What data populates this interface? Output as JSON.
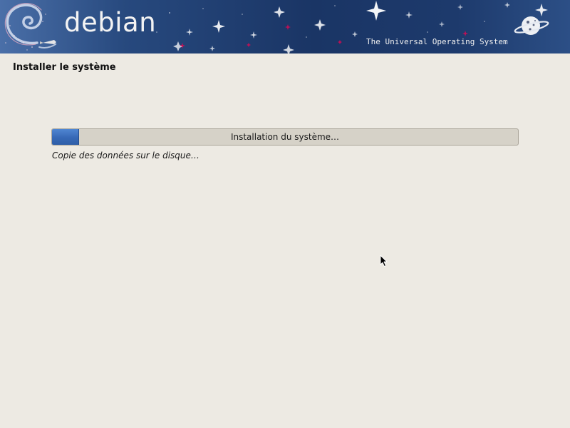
{
  "banner": {
    "logo_text": "debian",
    "tagline": "The Universal Operating System",
    "logo_icon": "debian-swirl-icon",
    "planet_icon": "planet-icon"
  },
  "page": {
    "title": "Installer le système"
  },
  "progress": {
    "label": "Installation du système…",
    "fraction": 0.057,
    "fill_color": "#3668b6"
  },
  "status": {
    "text": "Copie des données sur le disque…"
  },
  "colors": {
    "background": "#edeae3",
    "banner": "#1a3565",
    "accent_red": "#d70a53"
  }
}
